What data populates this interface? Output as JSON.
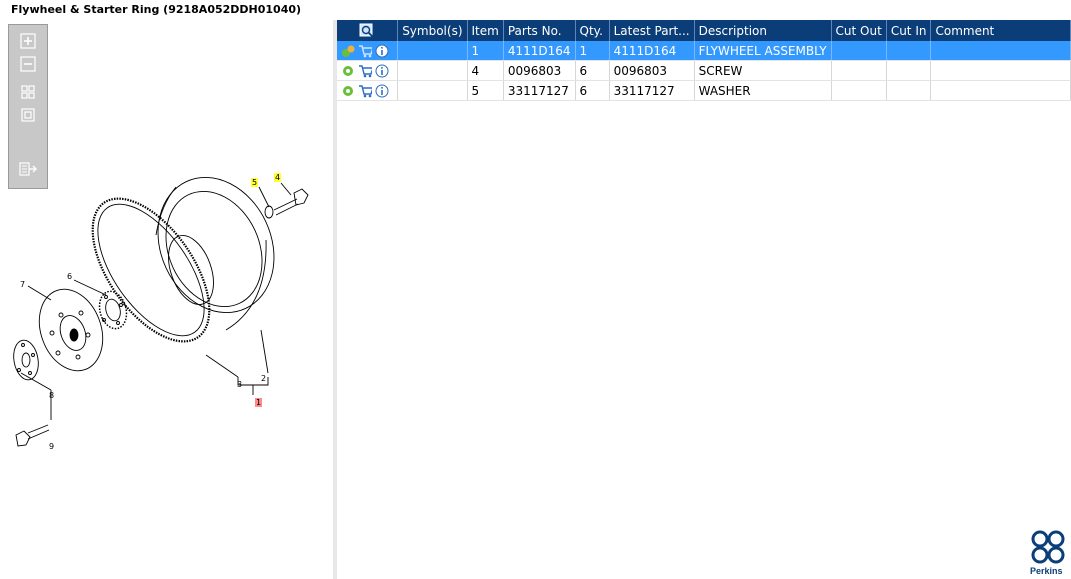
{
  "window": {
    "title": "Flywheel & Starter Ring (9218A052DDH01040)"
  },
  "toolbar": {
    "buttons": [
      {
        "name": "zoom-in-button",
        "icon": "zoom-in-icon"
      },
      {
        "name": "zoom-out-button",
        "icon": "zoom-out-icon"
      },
      {
        "name": "fit-all-button",
        "icon": "fit-all-icon"
      },
      {
        "name": "fit-page-button",
        "icon": "fit-page-icon"
      },
      {
        "name": "export-button",
        "icon": "export-icon"
      }
    ]
  },
  "diagram": {
    "callouts": {
      "c1": "1",
      "c2": "2",
      "c3": "3",
      "c4": "4",
      "c5": "5",
      "c6": "6",
      "c7": "7",
      "c8": "8",
      "c9": "9"
    }
  },
  "table": {
    "headers": {
      "search": "",
      "symbols": "Symbol(s)",
      "item": "Item",
      "parts_no": "Parts No.",
      "qty": "Qty.",
      "latest_part": "Latest Part...",
      "description": "Description",
      "cut_out": "Cut Out",
      "cut_in": "Cut In",
      "comment": "Comment"
    },
    "rows": [
      {
        "item": "1",
        "parts_no": "4111D164",
        "qty": "1",
        "latest_part": "4111D164",
        "description": "FLYWHEEL ASSEMBLY",
        "cut_out": "",
        "cut_in": "",
        "comment": "",
        "selected": true
      },
      {
        "item": "4",
        "parts_no": "0096803",
        "qty": "6",
        "latest_part": "0096803",
        "description": "SCREW",
        "cut_out": "",
        "cut_in": "",
        "comment": "",
        "selected": false
      },
      {
        "item": "5",
        "parts_no": "33117127",
        "qty": "6",
        "latest_part": "33117127",
        "description": "WASHER",
        "cut_out": "",
        "cut_in": "",
        "comment": "",
        "selected": false
      }
    ]
  },
  "logo": {
    "text": "Perkins"
  },
  "colors": {
    "header": "#0b3e78",
    "selected": "#3399ff",
    "highlight_yellow": "#ffff33",
    "highlight_red": "#ff8a8a"
  }
}
